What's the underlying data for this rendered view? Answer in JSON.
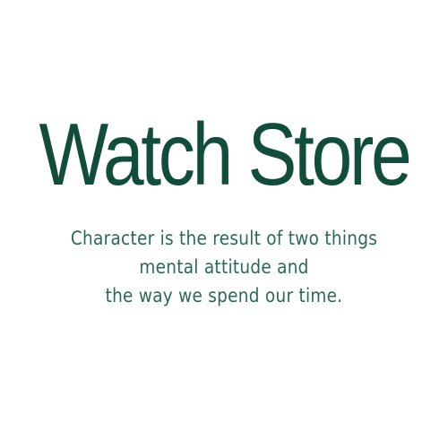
{
  "colors": {
    "brand": "#114d3c",
    "tagline": "#2a6a57",
    "background": "#ffffff"
  },
  "logo": {
    "brand_name": "Watch Store",
    "tagline_lines": [
      "Character is the result of two things",
      "mental attitude and",
      "the way we spend our time."
    ]
  }
}
